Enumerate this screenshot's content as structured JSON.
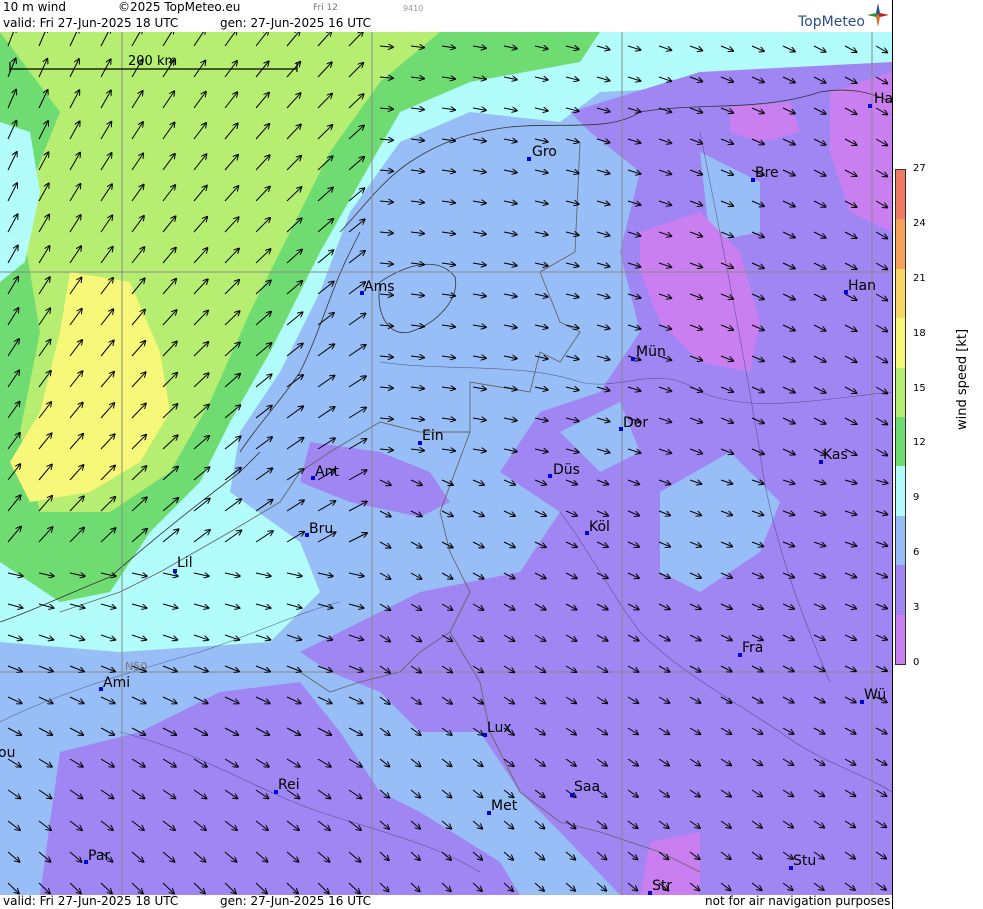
{
  "header": {
    "product": "10 m wind",
    "copyright": "©2025 TopMeteo.eu",
    "run_label": "Fri 12",
    "code": "9410",
    "valid": "valid:  Fri  27-Jun-2025  18 UTC",
    "gen": "gen: 27-Jun-2025 16 UTC",
    "logo_text": "TopMeteo"
  },
  "footer": {
    "valid": "valid:  Fri  27-Jun-2025  18 UTC",
    "gen": "gen: 27-Jun-2025 16 UTC",
    "disclaimer": "not for air navigation purposes"
  },
  "map": {
    "scale_label": "200 km",
    "latitude_label": "N50",
    "cities": [
      {
        "name": "Ha"
      },
      {
        "name": "Gro"
      },
      {
        "name": "Bre"
      },
      {
        "name": "Ams"
      },
      {
        "name": "Han"
      },
      {
        "name": "Mün"
      },
      {
        "name": "Dor"
      },
      {
        "name": "Ein"
      },
      {
        "name": "Ant"
      },
      {
        "name": "Düs"
      },
      {
        "name": "Kas"
      },
      {
        "name": "Bru"
      },
      {
        "name": "Köl"
      },
      {
        "name": "Lil"
      },
      {
        "name": "Fra"
      },
      {
        "name": "Ami"
      },
      {
        "name": "Wü"
      },
      {
        "name": "Lux"
      },
      {
        "name": "ou"
      },
      {
        "name": "Rei"
      },
      {
        "name": "Saa"
      },
      {
        "name": "Met"
      },
      {
        "name": "Stu"
      },
      {
        "name": "Par"
      },
      {
        "name": "Str"
      }
    ]
  },
  "legend": {
    "title": "wind  speed  [kt]",
    "ticks": [
      "27",
      "24",
      "21",
      "18",
      "15",
      "12",
      "9",
      "6",
      "3",
      "0"
    ],
    "colors": [
      "#ee7a62",
      "#f6a15a",
      "#f8d665",
      "#f7f77a",
      "#b6ee72",
      "#6fdc72",
      "#b2fdfb",
      "#98bef7",
      "#9f86f3",
      "#c97ff0"
    ]
  }
}
